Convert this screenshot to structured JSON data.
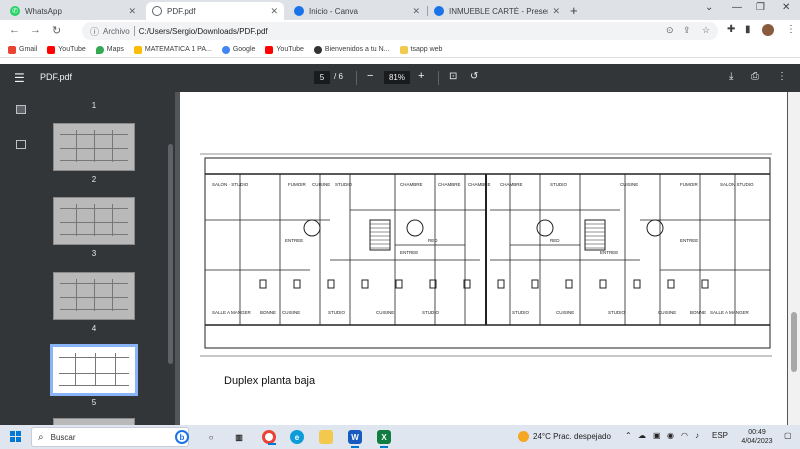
{
  "tabs": [
    {
      "title": "WhatsApp",
      "icon": "whatsapp-icon",
      "color": "#25d366",
      "active": false
    },
    {
      "title": "PDF.pdf",
      "icon": "globe-icon",
      "color": "#5f6368",
      "active": true
    },
    {
      "title": "Inicio - Canva",
      "icon": "chrome-icon",
      "color": "#1a73e8",
      "active": false
    },
    {
      "title": "INMUEBLE CARTÉ - Presentación",
      "icon": "chrome-icon",
      "color": "#1a73e8",
      "active": false
    }
  ],
  "omnibox": {
    "scheme_label": "Archivo",
    "url": "C:/Users/Sergio/Downloads/PDF.pdf"
  },
  "bookmarks": [
    {
      "label": "Gmail",
      "icon": "gmail-icon",
      "color": "#ea4335"
    },
    {
      "label": "YouTube",
      "icon": "youtube-icon",
      "color": "#ff0000"
    },
    {
      "label": "Maps",
      "icon": "maps-icon",
      "color": "#34a853"
    },
    {
      "label": "MATEMATICA 1 PA...",
      "icon": "drive-icon",
      "color": "#fbbc04"
    },
    {
      "label": "Google",
      "icon": "google-icon",
      "color": "#4285f4"
    },
    {
      "label": "YouTube",
      "icon": "youtube-icon",
      "color": "#ff0000"
    },
    {
      "label": "Bienvenidos a tu N...",
      "icon": "site-icon",
      "color": "#333333"
    },
    {
      "label": "tsapp web",
      "icon": "folder-icon",
      "color": "#f2c94c"
    }
  ],
  "pdf": {
    "title": "PDF.pdf",
    "current_page": "5",
    "page_total": "/  6",
    "zoom": "81%",
    "caption": "Duplex planta baja",
    "thumbnails": [
      {
        "label": "1"
      },
      {
        "label": "2"
      },
      {
        "label": "3"
      },
      {
        "label": "4"
      },
      {
        "label": "5",
        "selected": true
      }
    ],
    "plan_labels": [
      "SALON · STUDIO",
      "FUMOIR",
      "CUISINE",
      "STUDIO",
      "CHAMBRE",
      "CHAMBRE",
      "CHAMBRE",
      "CHAMBRE",
      "STUDIO",
      "CUISINE",
      "FUMOIR",
      "SALON STUDIO",
      "ENTREE",
      "ENTREE",
      "RED",
      "RED",
      "ENTREE",
      "ENTREE",
      "SALLE A MANGER",
      "BONNE",
      "CUISINE",
      "STUDIO",
      "CUISINE",
      "STUDIO",
      "STUDIO",
      "CUISINE",
      "STUDIO",
      "CUISINE",
      "BONNE",
      "SALLE A MANGER"
    ]
  },
  "taskbar": {
    "search_placeholder": "Buscar",
    "weather": "24°C  Prac. despejado",
    "lang": "ESP",
    "time": "00:49",
    "date": "4/04/2023"
  }
}
